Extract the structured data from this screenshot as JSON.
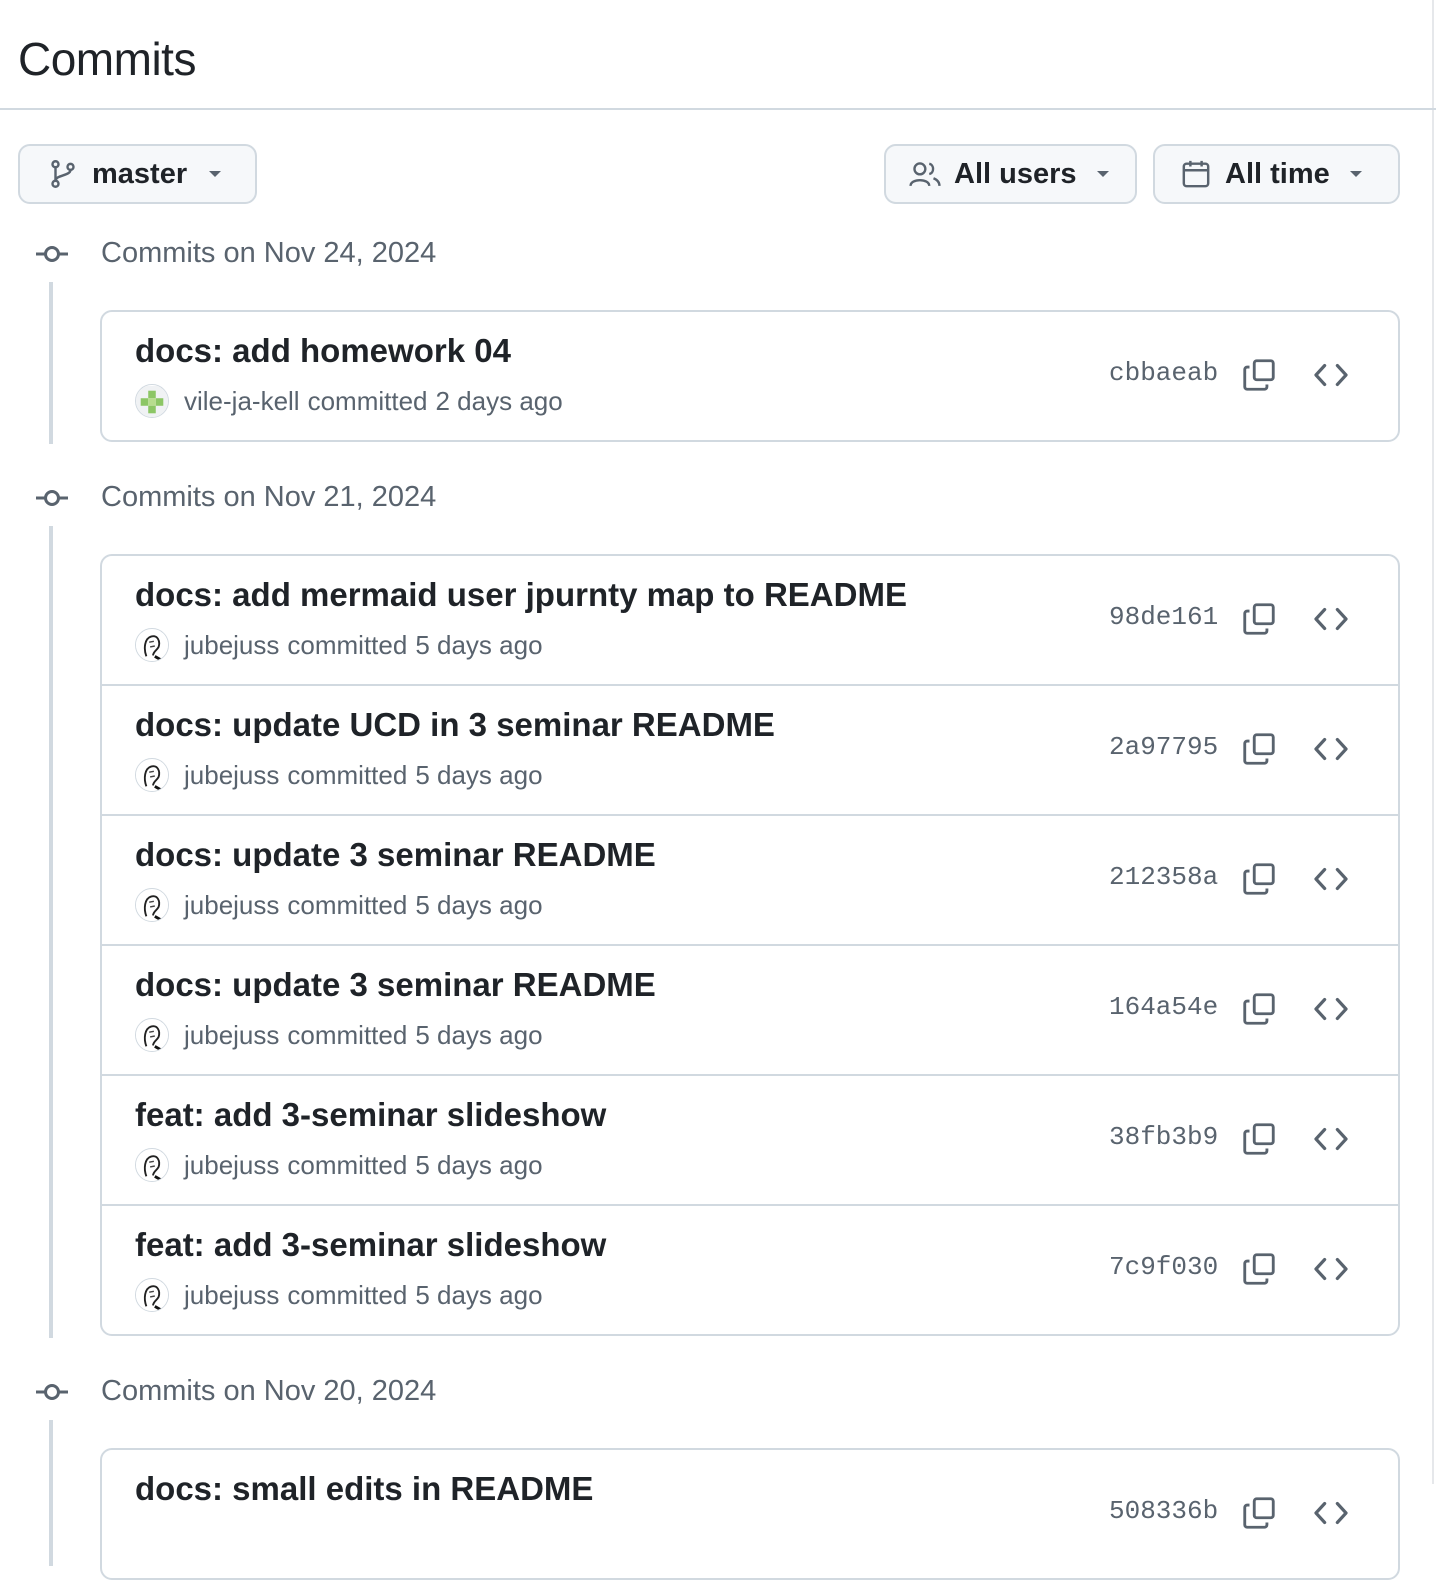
{
  "page": {
    "title": "Commits"
  },
  "filters": {
    "branch": {
      "label": "master",
      "icon": "git-branch-icon"
    },
    "users": {
      "label": "All users",
      "icon": "people-icon"
    },
    "time": {
      "label": "All time",
      "icon": "calendar-icon"
    }
  },
  "groups": [
    {
      "date_label": "Commits on Nov 24, 2024",
      "commits": [
        {
          "message": "docs: add homework 04",
          "author": "vile-ja-kell",
          "action": "committed",
          "time": "2 days ago",
          "sha": "cbbaeab"
        }
      ]
    },
    {
      "date_label": "Commits on Nov 21, 2024",
      "commits": [
        {
          "message": "docs: add mermaid user jpurnty map to README",
          "author": "jubejuss",
          "action": "committed",
          "time": "5 days ago",
          "sha": "98de161"
        },
        {
          "message": "docs: update UCD in 3 seminar README",
          "author": "jubejuss",
          "action": "committed",
          "time": "5 days ago",
          "sha": "2a97795"
        },
        {
          "message": "docs: update 3 seminar README",
          "author": "jubejuss",
          "action": "committed",
          "time": "5 days ago",
          "sha": "212358a"
        },
        {
          "message": "docs: update 3 seminar README",
          "author": "jubejuss",
          "action": "committed",
          "time": "5 days ago",
          "sha": "164a54e"
        },
        {
          "message": "feat: add 3-seminar slideshow",
          "author": "jubejuss",
          "action": "committed",
          "time": "5 days ago",
          "sha": "38fb3b9"
        },
        {
          "message": "feat: add 3-seminar slideshow",
          "author": "jubejuss",
          "action": "committed",
          "time": "5 days ago",
          "sha": "7c9f030"
        }
      ]
    },
    {
      "date_label": "Commits on Nov 20, 2024",
      "commits": [
        {
          "message": "docs: small edits in README",
          "sha": "508336b"
        }
      ]
    }
  ],
  "colors": {
    "text": "#1f2328",
    "muted": "#59636e",
    "border": "#d1d9e0",
    "button_bg": "#f6f8fa"
  }
}
